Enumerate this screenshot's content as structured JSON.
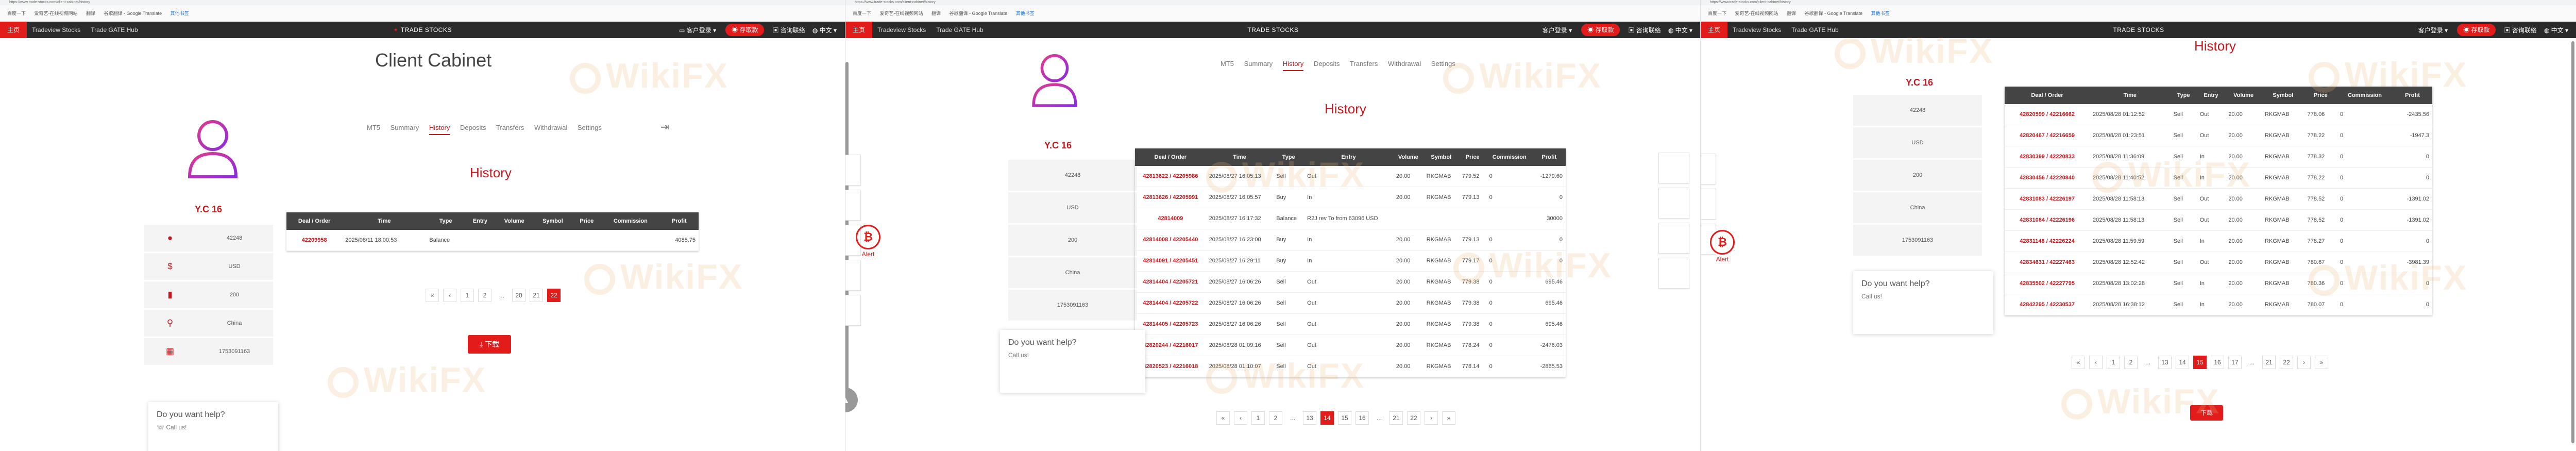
{
  "browser": {
    "url1": "https://www.trade-stocks.com/client-cabinet/history",
    "url2": "https://www.trade-stocks.com/client-cabinet/history",
    "url3": "https://www.trade-stocks.com/client-cabinet/history",
    "bookmarks": [
      "百度一下",
      "爱奇艺-在线视频网站",
      "翻译",
      "谷歌翻译 - Google Translate",
      "其他书签"
    ]
  },
  "nav": {
    "home": "主页",
    "tradeview": "Tradeview Stocks",
    "gate": "Trade GATE Hub",
    "brand": "TRADE STOCKS",
    "account": "客户登录",
    "deposit": "存取款",
    "contact": "咨询联络",
    "lang": "中文"
  },
  "cabinet": {
    "title": "Client Cabinet",
    "username": "Y.C 16",
    "info": [
      "42248",
      "USD",
      "200",
      "China",
      "1753091163"
    ],
    "tabs": [
      "MT5",
      "Summary",
      "History",
      "Deposits",
      "Transfers",
      "Withdrawal",
      "Settings"
    ],
    "active_tab": "History",
    "section_title": "History",
    "download": "下载",
    "help_title": "Do you want help?",
    "help_sub": "Call us!",
    "alert": "Alert"
  },
  "table": {
    "headers": [
      "Deal / Order",
      "Time",
      "Type",
      "Entry",
      "Volume",
      "Symbol",
      "Price",
      "Commission",
      "Profit"
    ]
  },
  "panel1": {
    "rows": [
      [
        "42209958",
        "2025/08/11 18:00:53",
        "Balance",
        "",
        "",
        "",
        "",
        "",
        "4085.75"
      ]
    ],
    "pager": [
      "«",
      "‹",
      "1",
      "2",
      "...",
      "20",
      "21",
      "22"
    ],
    "active_page": "22"
  },
  "panel2": {
    "info": [
      "42248",
      "USD",
      "200",
      "China",
      "1753091163"
    ],
    "rows": [
      [
        "42813622 / 42205986",
        "2025/08/27 16:05:13",
        "Sell",
        "Out",
        "20.00",
        "RKGMAB",
        "779.52",
        "0",
        "-1279.60"
      ],
      [
        "42813626 / 42205991",
        "2025/08/27 16:05:57",
        "Buy",
        "In",
        "20.00",
        "RKGMAB",
        "779.13",
        "0",
        "0"
      ],
      [
        "42814009",
        "2025/08/27 16:17:32",
        "Balance",
        "R2J rev To from 63096 USD",
        "",
        "",
        "",
        "",
        "30000"
      ],
      [
        "42814008 / 42205440",
        "2025/08/27 16:23:00",
        "Buy",
        "In",
        "20.00",
        "RKGMAB",
        "779.13",
        "0",
        "0"
      ],
      [
        "42814091 / 42205451",
        "2025/08/27 16:29:11",
        "Buy",
        "In",
        "20.00",
        "RKGMAB",
        "779.17",
        "0",
        "0"
      ],
      [
        "42814404 / 42205721",
        "2025/08/27 16:06:26",
        "Sell",
        "Out",
        "20.00",
        "RKGMAB",
        "779.38",
        "0",
        "695.46"
      ],
      [
        "42814404 / 42205722",
        "2025/08/27 16:06:26",
        "Sell",
        "Out",
        "20.00",
        "RKGMAB",
        "779.38",
        "0",
        "695.46"
      ],
      [
        "42814405 / 42205723",
        "2025/08/27 16:06:26",
        "Sell",
        "Out",
        "20.00",
        "RKGMAB",
        "779.38",
        "0",
        "695.46"
      ],
      [
        "42820244 / 42216017",
        "2025/08/28 01:09:16",
        "Sell",
        "Out",
        "20.00",
        "RKGMAB",
        "778.24",
        "0",
        "-2476.03"
      ],
      [
        "42820523 / 42216018",
        "2025/08/28 01:10:07",
        "Sell",
        "Out",
        "20.00",
        "RKGMAB",
        "778.14",
        "0",
        "-2865.53"
      ]
    ],
    "pager": [
      "«",
      "‹",
      "1",
      "2",
      "...",
      "13",
      "14",
      "15",
      "16",
      "...",
      "21",
      "22",
      "›",
      "»"
    ],
    "active_page": "14"
  },
  "panel3": {
    "rows": [
      [
        "42820599 / 42216662",
        "2025/08/28 01:12:52",
        "Sell",
        "Out",
        "20.00",
        "RKGMAB",
        "778.06",
        "0",
        "-2435.56"
      ],
      [
        "42820467 / 42216659",
        "2025/08/28 01:23:51",
        "Sell",
        "Out",
        "20.00",
        "RKGMAB",
        "778.22",
        "0",
        "-1947.3"
      ],
      [
        "42830399 / 42220833",
        "2025/08/28 11:36:09",
        "Sell",
        "In",
        "20.00",
        "RKGMAB",
        "778.32",
        "0",
        "0"
      ],
      [
        "42830456 / 42220840",
        "2025/08/28 11:40:52",
        "Sell",
        "In",
        "20.00",
        "RKGMAB",
        "778.22",
        "0",
        "0"
      ],
      [
        "42831083 / 42226197",
        "2025/08/28 11:58:13",
        "Sell",
        "Out",
        "20.00",
        "RKGMAB",
        "778.52",
        "0",
        "-1391.02"
      ],
      [
        "42831084 / 42226196",
        "2025/08/28 11:58:13",
        "Sell",
        "Out",
        "20.00",
        "RKGMAB",
        "778.52",
        "0",
        "-1391.02"
      ],
      [
        "42831148 / 42226224",
        "2025/08/28 11:59:59",
        "Sell",
        "In",
        "20.00",
        "RKGMAB",
        "778.27",
        "0",
        "0"
      ],
      [
        "42834631 / 42227463",
        "2025/08/28 12:52:42",
        "Sell",
        "Out",
        "20.00",
        "RKGMAB",
        "780.67",
        "0",
        "-3981.39"
      ],
      [
        "42835502 / 42227795",
        "2025/08/28 13:02:28",
        "Sell",
        "In",
        "20.00",
        "RKGMAB",
        "780.36",
        "0",
        "0"
      ],
      [
        "42842295 / 42230537",
        "2025/08/28 16:38:12",
        "Sell",
        "In",
        "20.00",
        "RKGMAB",
        "780.07",
        "0",
        "0"
      ]
    ],
    "pager": [
      "«",
      "‹",
      "1",
      "2",
      "...",
      "13",
      "14",
      "15",
      "16",
      "17",
      "...",
      "21",
      "22",
      "›",
      "»"
    ],
    "active_page": "15"
  },
  "watermark": "WikiFX"
}
